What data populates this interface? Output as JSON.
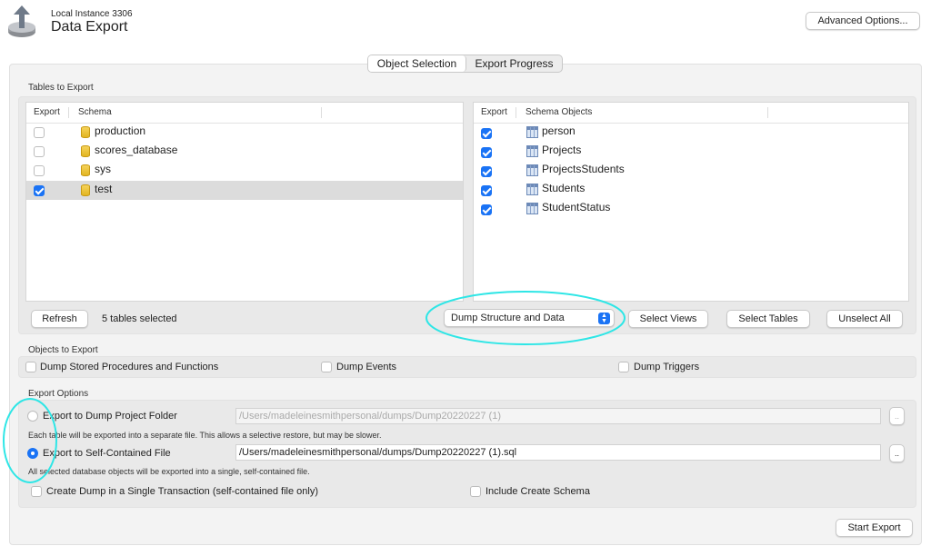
{
  "header": {
    "subtitle": "Local Instance 3306",
    "title": "Data Export",
    "advanced_button": "Advanced Options..."
  },
  "tabs": [
    {
      "label": "Object Selection",
      "active": true
    },
    {
      "label": "Export Progress",
      "active": false
    }
  ],
  "tables_section": {
    "label": "Tables to Export",
    "schema_table": {
      "columns": [
        "Export",
        "Schema"
      ],
      "rows": [
        {
          "name": "production",
          "checked": false
        },
        {
          "name": "scores_database",
          "checked": false
        },
        {
          "name": "sys",
          "checked": false
        },
        {
          "name": "test",
          "checked": true,
          "selected": true
        }
      ]
    },
    "objects_table": {
      "columns": [
        "Export",
        "Schema Objects"
      ],
      "rows": [
        {
          "name": "person",
          "checked": true
        },
        {
          "name": "Projects",
          "checked": true
        },
        {
          "name": "ProjectsStudents",
          "checked": true
        },
        {
          "name": "Students",
          "checked": true
        },
        {
          "name": "StudentStatus",
          "checked": true
        }
      ]
    },
    "refresh_button": "Refresh",
    "status": "5 tables selected",
    "dump_select": "Dump Structure and Data",
    "select_views": "Select Views",
    "select_tables": "Select Tables",
    "unselect_all": "Unselect All"
  },
  "objects_section": {
    "label": "Objects to Export",
    "options": [
      {
        "label": "Dump Stored Procedures and Functions",
        "checked": false
      },
      {
        "label": "Dump Events",
        "checked": false
      },
      {
        "label": "Dump Triggers",
        "checked": false
      }
    ]
  },
  "export_options": {
    "label": "Export Options",
    "folder": {
      "label": "Export to Dump Project Folder",
      "path": "/Users/madeleinesmithpersonal/dumps/Dump20220227 (1)",
      "help": "Each table will be exported into a separate file. This allows a selective restore, but may be slower.",
      "selected": false
    },
    "file": {
      "label": "Export to Self-Contained File",
      "path": "/Users/madeleinesmithpersonal/dumps/Dump20220227 (1).sql",
      "help": "All selected database objects will be exported into a single, self-contained file.",
      "selected": true
    },
    "browse_label": "..",
    "single_transaction": {
      "label": "Create Dump in a Single Transaction (self-contained file only)",
      "checked": false
    },
    "include_schema": {
      "label": "Include Create Schema",
      "checked": false
    }
  },
  "start_export": "Start Export",
  "colors": {
    "accent": "#1a73f5",
    "annotation": "#2ee6e6"
  }
}
